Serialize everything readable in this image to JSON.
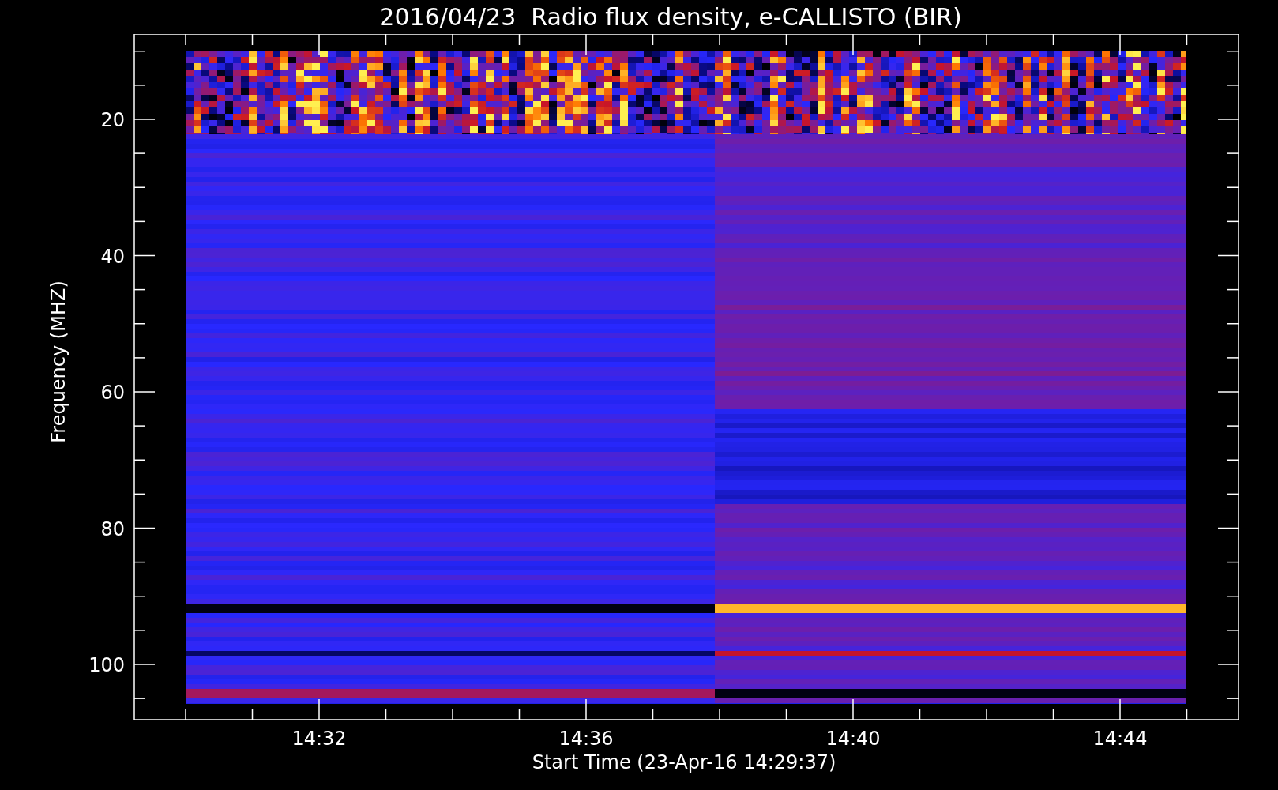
{
  "title": "2016/04/23  Radio flux density, e-CALLISTO (BIR)",
  "y_axis": {
    "label": "Frequency (MHZ)",
    "ticks": [
      "20",
      "40",
      "60",
      "80",
      "100"
    ]
  },
  "x_axis": {
    "label": "Start Time (23-Apr-16 14:29:37)",
    "ticks": [
      "14:32",
      "14:36",
      "14:40",
      "14:44"
    ]
  }
}
